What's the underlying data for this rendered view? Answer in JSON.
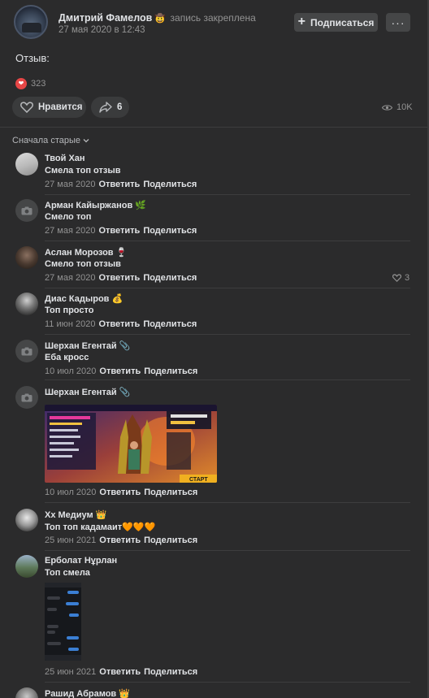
{
  "post": {
    "author": "Дмитрий Фамелов",
    "author_badge": "🤠",
    "pinned_note": "запись закреплена",
    "date": "27 мая 2020 в 12:43",
    "subscribe_label": "Подписаться",
    "more_label": "···",
    "text": "Отзыв:",
    "reaction_count": "323",
    "like_label": "Нравится",
    "share_count": "6",
    "views": "10K"
  },
  "comments_header": {
    "sort_label": "Сначала старые"
  },
  "comments": [
    {
      "name": "Твой Хан",
      "badge": "",
      "text": "Смела топ отзыв",
      "date": "27 мая 2020",
      "reply": "Ответить",
      "share": "Поделиться",
      "likes": ""
    },
    {
      "name": "Арман Кайыржанов",
      "badge": "🌿",
      "text": "Смело топ",
      "date": "27 мая 2020",
      "reply": "Ответить",
      "share": "Поделиться",
      "likes": ""
    },
    {
      "name": "Аслан Морозов",
      "badge": "🍷",
      "text": "Смело топ отзыв",
      "date": "27 мая 2020",
      "reply": "Ответить",
      "share": "Поделиться",
      "likes": "3"
    },
    {
      "name": "Диас Кадыров",
      "badge": "💰",
      "text": "Топ просто",
      "date": "11 июн 2020",
      "reply": "Ответить",
      "share": "Поделиться",
      "likes": ""
    },
    {
      "name": "Шерхан Егентай",
      "badge": "📎",
      "text": "Еба кросс",
      "date": "10 июл 2020",
      "reply": "Ответить",
      "share": "Поделиться",
      "likes": ""
    },
    {
      "name": "Шерхан Егентай",
      "badge": "📎",
      "text": "",
      "date": "10 июл 2020",
      "reply": "Ответить",
      "share": "Поделиться",
      "likes": ""
    },
    {
      "name": "Xx Медиум",
      "badge": "👑",
      "text": "Топ топ кадамаит🧡🧡🧡",
      "date": "25 июн 2021",
      "reply": "Ответить",
      "share": "Поделиться",
      "likes": ""
    },
    {
      "name": "Ерболат Нұрлан",
      "badge": "",
      "text": "Топ смела",
      "date": "25 июн 2021",
      "reply": "Ответить",
      "share": "Поделиться",
      "likes": ""
    },
    {
      "name": "Рашид Абрамов",
      "badge": "👑",
      "text": "",
      "date": "",
      "reply": "",
      "share": "",
      "likes": ""
    }
  ],
  "game_screenshot": {
    "start_label": "СТАРТ"
  },
  "colors": {
    "background": "#2b2b2c",
    "button": "#454647",
    "pill": "#3a3b3c",
    "text_primary": "#e1e3e6",
    "text_secondary": "#939393",
    "reaction": "#e64646"
  }
}
